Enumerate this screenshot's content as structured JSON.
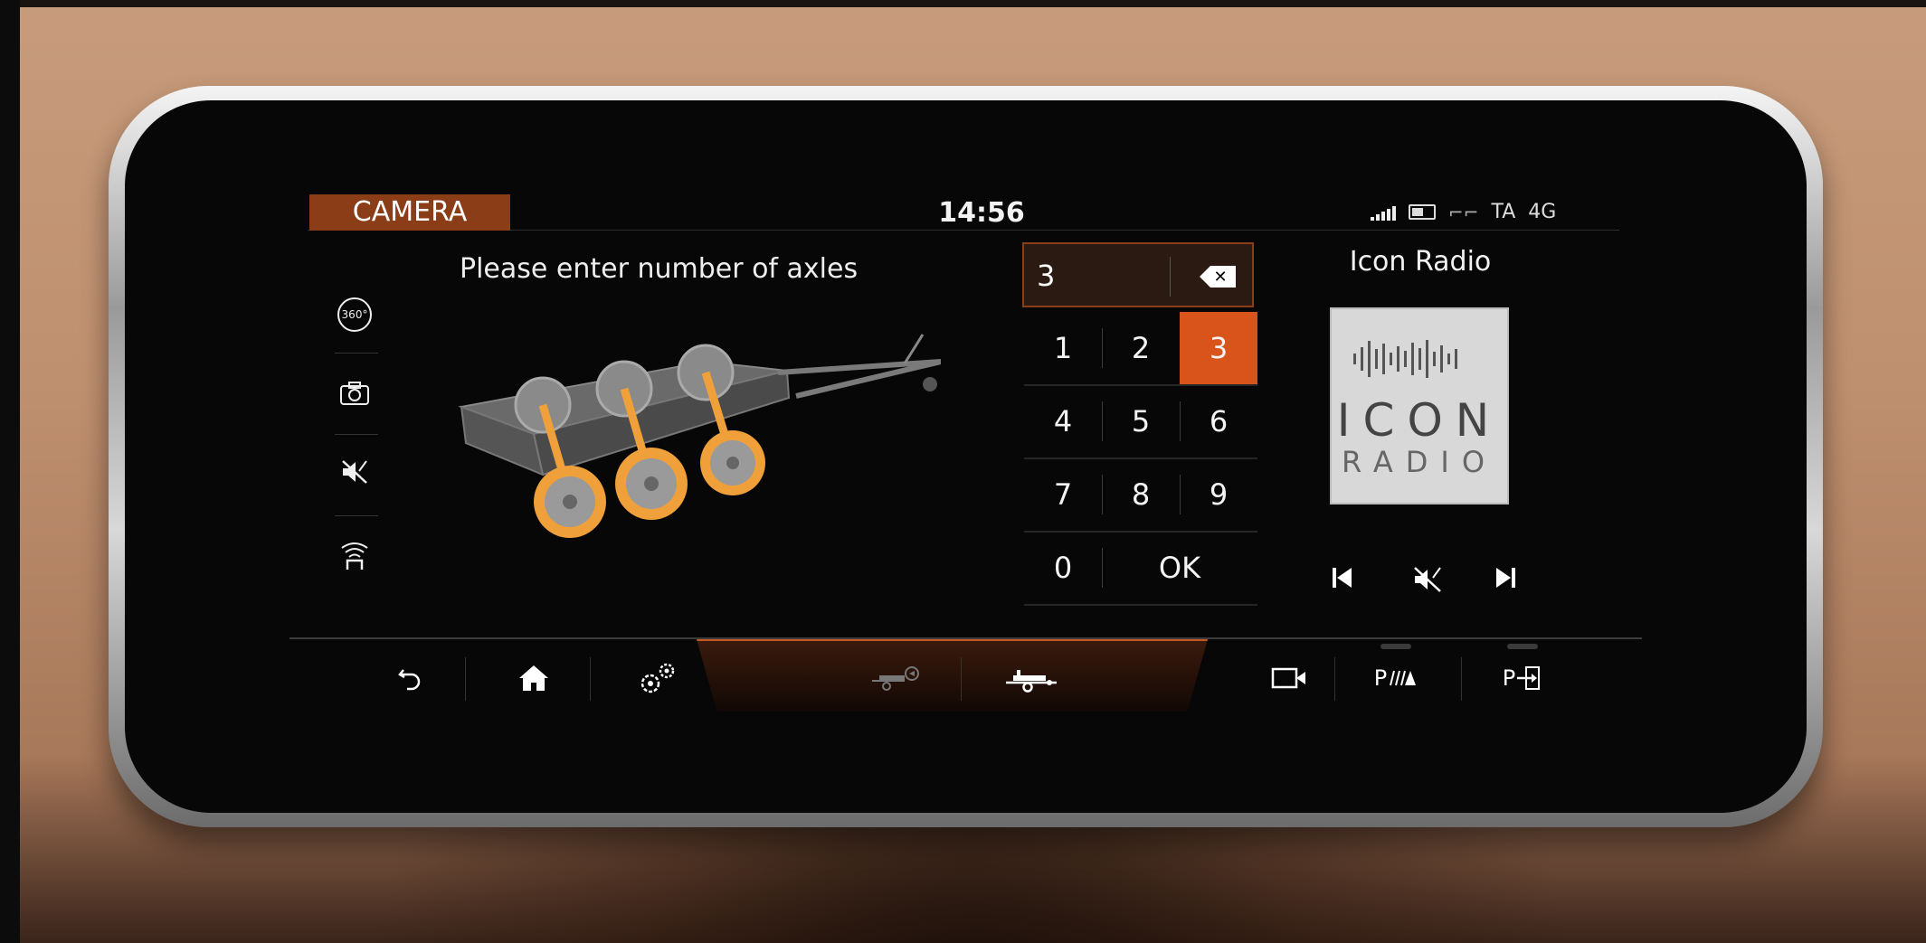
{
  "status": {
    "tab_label": "CAMERA",
    "clock": "14:56",
    "ta": "TA",
    "network": "4G"
  },
  "camera": {
    "prompt": "Please enter number of axles",
    "side_label_360": "360°"
  },
  "keypad": {
    "entry_value": "3",
    "keys": [
      "1",
      "2",
      "3",
      "4",
      "5",
      "6",
      "7",
      "8",
      "9",
      "0"
    ],
    "ok_label": "OK",
    "selected_key": "3"
  },
  "radio": {
    "station": "Icon Radio",
    "logo_top": "ICON",
    "logo_bottom": "RADIO"
  },
  "bottom_nav": {
    "park_label": "P"
  },
  "colors": {
    "accent": "#d9541a",
    "tab_bg": "#8a3d16",
    "axle_orange": "#f0a03a"
  }
}
